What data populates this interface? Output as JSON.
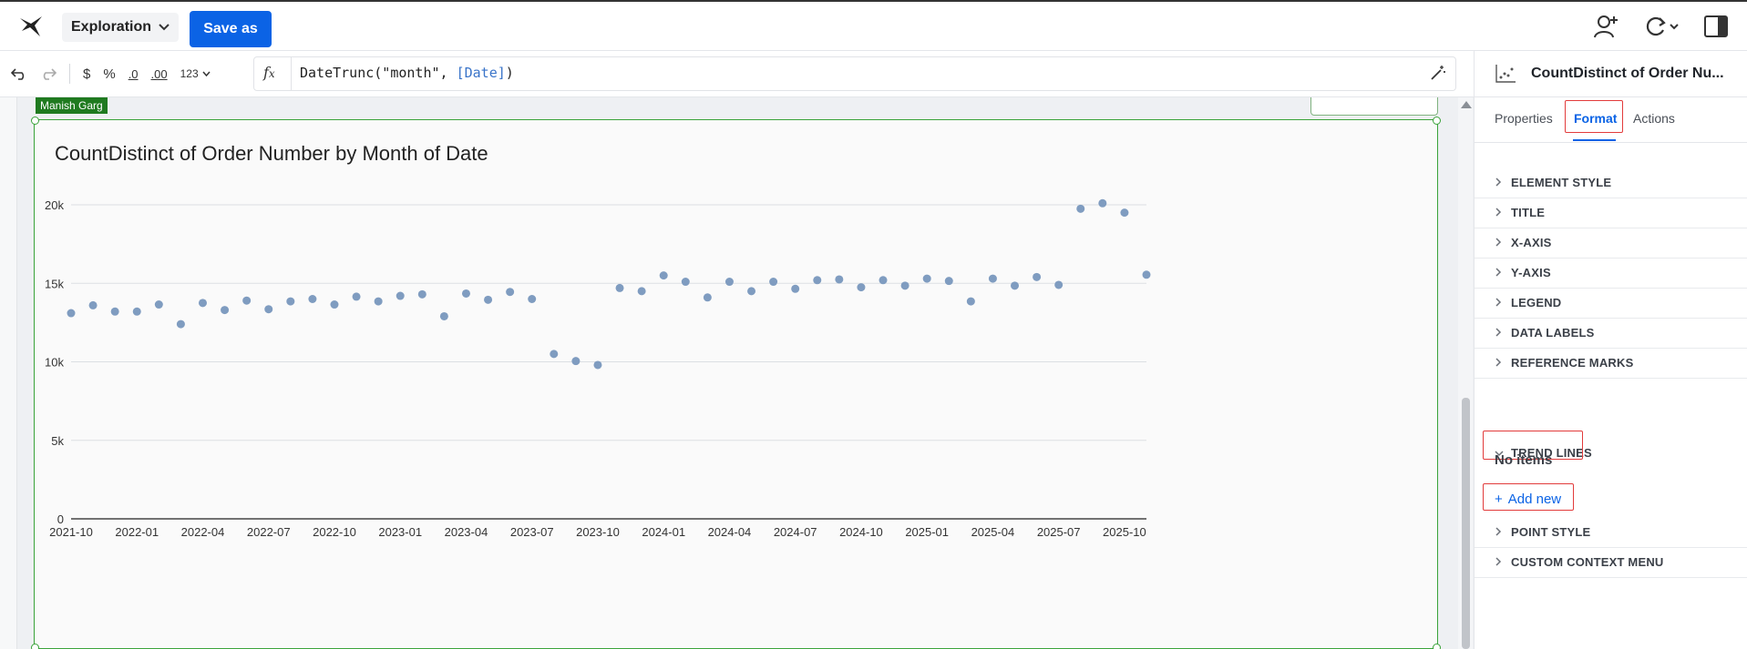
{
  "app": {
    "mode_label": "Exploration",
    "save_label": "Save as"
  },
  "formula_bar": {
    "tools": [
      "$",
      "%",
      ".0",
      ".00",
      "123"
    ],
    "expression_prefix": "DateTrunc(\"month\", ",
    "expression_column": "[Date]",
    "expression_suffix": ")"
  },
  "canvas": {
    "author_tag": "Manish Garg"
  },
  "chart_data": {
    "type": "scatter",
    "title": "CountDistinct of Order Number by Month of Date",
    "xlabel": "",
    "ylabel": "",
    "x_tick_labels": [
      "2021-10",
      "2022-01",
      "2022-04",
      "2022-07",
      "2022-10",
      "2023-01",
      "2023-04",
      "2023-07",
      "2023-10",
      "2024-01",
      "2024-04",
      "2024-07",
      "2024-10",
      "2025-01",
      "2025-04",
      "2025-07",
      "2025-10"
    ],
    "y_tick_labels": [
      "0",
      "5k",
      "10k",
      "15k",
      "20k"
    ],
    "ylim": [
      0,
      20000
    ],
    "grid": true,
    "color": "#7f9cc0",
    "x": [
      "2021-10",
      "2021-11",
      "2021-12",
      "2022-01",
      "2022-02",
      "2022-03",
      "2022-04",
      "2022-05",
      "2022-06",
      "2022-07",
      "2022-08",
      "2022-09",
      "2022-10",
      "2022-11",
      "2022-12",
      "2023-01",
      "2023-02",
      "2023-03",
      "2023-04",
      "2023-05",
      "2023-06",
      "2023-07",
      "2023-08",
      "2023-09",
      "2023-10",
      "2023-11",
      "2023-12",
      "2024-01",
      "2024-02",
      "2024-03",
      "2024-04",
      "2024-05",
      "2024-06",
      "2024-07",
      "2024-08",
      "2024-09",
      "2024-10",
      "2024-11",
      "2024-12",
      "2025-01",
      "2025-02",
      "2025-03",
      "2025-04",
      "2025-05",
      "2025-06",
      "2025-07",
      "2025-08",
      "2025-09",
      "2025-10"
    ],
    "values": [
      13100,
      13600,
      13200,
      13200,
      13650,
      12400,
      13750,
      13300,
      13900,
      13350,
      13850,
      14000,
      13650,
      14150,
      13850,
      14200,
      14300,
      12900,
      14350,
      13950,
      14450,
      14000,
      10500,
      10050,
      9800,
      14700,
      14500,
      15500,
      15100,
      14100,
      15100,
      14500,
      15100,
      14650,
      15200,
      15250,
      14750,
      15200,
      14850,
      15300,
      15150,
      13850,
      15300,
      14850,
      15400,
      14900,
      19750,
      20100,
      19500,
      15550
    ]
  },
  "panel": {
    "element_title": "CountDistinct of Order Nu...",
    "tabs": [
      "Properties",
      "Format",
      "Actions"
    ],
    "sections_top": [
      "ELEMENT STYLE",
      "TITLE",
      "X-AXIS",
      "Y-AXIS",
      "LEGEND",
      "DATA LABELS",
      "REFERENCE MARKS"
    ],
    "trend_lines": "TRENDLINES_PLACEHOLDER",
    "no_items": "No items",
    "add_new": "Add new",
    "sections_bottom": [
      "POINT STYLE",
      "CUSTOM CONTEXT MENU"
    ]
  }
}
